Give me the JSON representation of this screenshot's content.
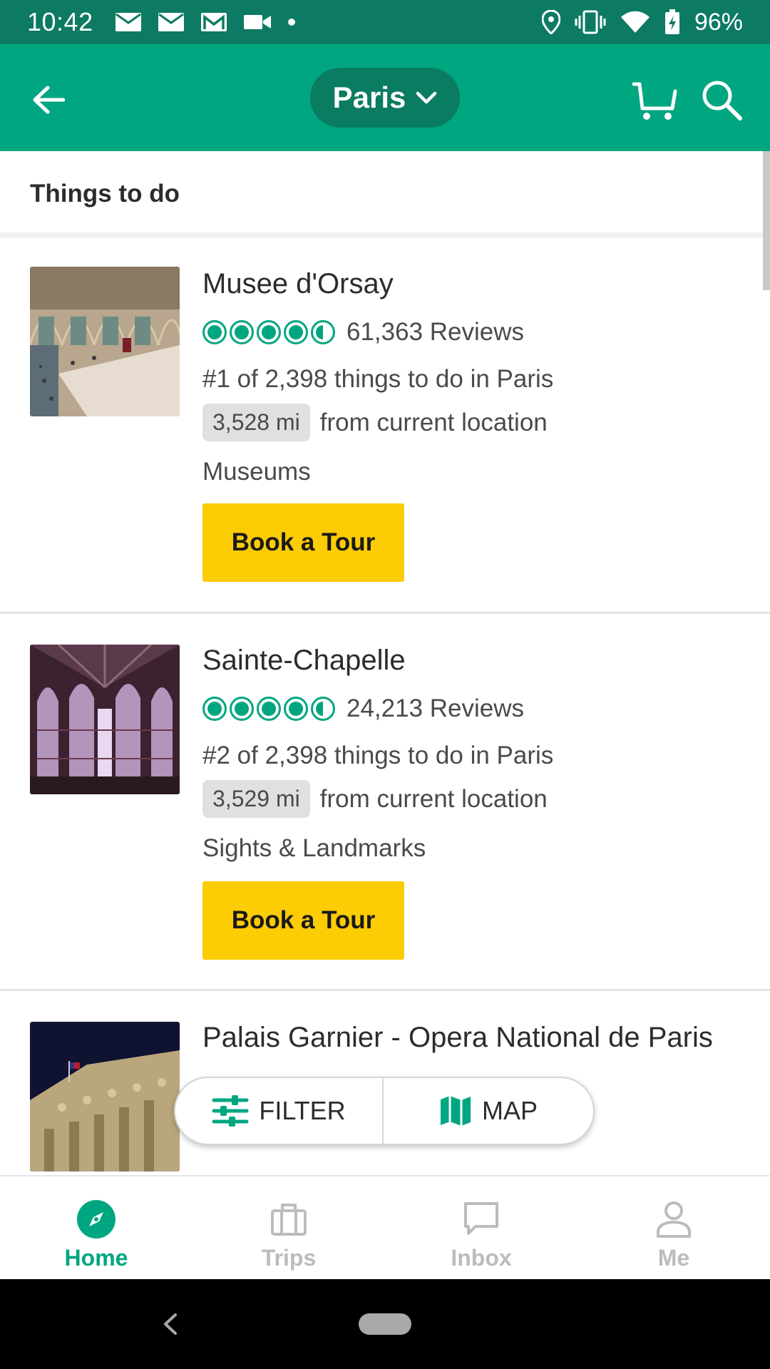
{
  "status_bar": {
    "time": "10:42",
    "battery": "96%",
    "icons_left": [
      "mail-icon",
      "mail-icon",
      "gmail-icon",
      "video-camera-icon",
      "dot-icon"
    ],
    "icons_right": [
      "location-pin-icon",
      "vibrate-icon",
      "wifi-icon",
      "battery-icon"
    ]
  },
  "app_bar": {
    "location": "Paris",
    "icons": [
      "back-arrow-icon",
      "chevron-down-icon",
      "cart-icon",
      "search-icon"
    ]
  },
  "section": {
    "title": "Things to do"
  },
  "listings": [
    {
      "title": "Musee d'Orsay",
      "rating": 4.5,
      "reviews": "61,363 Reviews",
      "rank": "#1 of 2,398 things to do in Paris",
      "distance": "3,528 mi",
      "distance_label": "from current location",
      "category": "Museums",
      "button": "Book a Tour"
    },
    {
      "title": "Sainte-Chapelle",
      "rating": 4.5,
      "reviews": "24,213 Reviews",
      "rank": "#2 of 2,398 things to do in Paris",
      "distance": "3,529 mi",
      "distance_label": "from current location",
      "category": "Sights & Landmarks",
      "button": "Book a Tour"
    },
    {
      "title": "Palais Garnier - Opera National de Paris"
    }
  ],
  "float_bar": {
    "filter": "FILTER",
    "map": "MAP"
  },
  "bottom_nav": [
    {
      "label": "Home",
      "icon": "compass-icon",
      "active": true
    },
    {
      "label": "Trips",
      "icon": "suitcase-icon",
      "active": false
    },
    {
      "label": "Inbox",
      "icon": "chat-bubble-icon",
      "active": false
    },
    {
      "label": "Me",
      "icon": "person-icon",
      "active": false
    }
  ],
  "colors": {
    "status_bar": "#0d7a63",
    "brand_green": "#00a680",
    "location_pill": "#0a7c61",
    "book_button": "#fccc05",
    "inactive_nav": "#bcbcbc"
  }
}
